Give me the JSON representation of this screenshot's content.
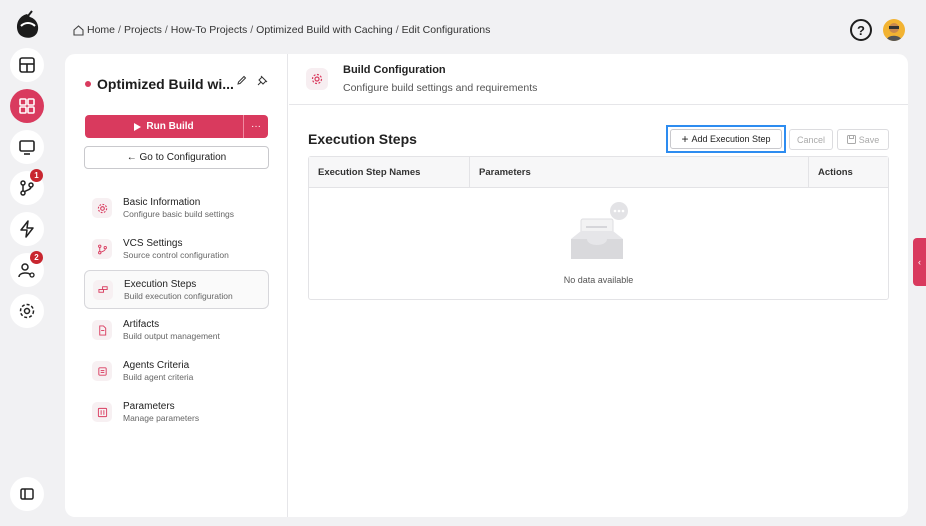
{
  "breadcrumb": {
    "items": [
      "Home",
      "Projects",
      "How-To Projects",
      "Optimized Build with Caching",
      "Edit Configurations"
    ],
    "separator": "/"
  },
  "header": {
    "help_label": "?"
  },
  "rail": {
    "badges": {
      "vcs": "1",
      "agents": "2"
    },
    "icons": [
      "logo-icon",
      "dashboard-icon",
      "projects-icon",
      "monitor-icon",
      "branch-icon",
      "lightning-icon",
      "agents-icon",
      "settings-icon",
      "sidebar-toggle-icon"
    ]
  },
  "project": {
    "title": "Optimized Build wi...",
    "run_label": "Run Build",
    "more_label": "···",
    "goto_label": "← Go to Configuration"
  },
  "nav": {
    "items": [
      {
        "label": "Basic Information",
        "sub": "Configure basic build settings",
        "icon": "gear-icon"
      },
      {
        "label": "VCS Settings",
        "sub": "Source control configuration",
        "icon": "branch-icon"
      },
      {
        "label": "Execution Steps",
        "sub": "Build execution configuration",
        "icon": "steps-icon"
      },
      {
        "label": "Artifacts",
        "sub": "Build output management",
        "icon": "file-icon"
      },
      {
        "label": "Agents Criteria",
        "sub": "Build agent criteria",
        "icon": "agent-icon"
      },
      {
        "label": "Parameters",
        "sub": "Manage parameters",
        "icon": "parameters-icon"
      }
    ],
    "active_index": 2
  },
  "config": {
    "title": "Build Configuration",
    "subtitle": "Configure build settings and requirements"
  },
  "steps": {
    "title": "Execution Steps",
    "add_label": "Add Execution Step",
    "cancel_label": "Cancel",
    "save_label": "Save",
    "columns": [
      "Execution Step Names",
      "Parameters",
      "Actions"
    ],
    "empty_text": "No data available"
  },
  "colors": {
    "accent": "#d93a5e",
    "focus": "#2d8cf0"
  }
}
